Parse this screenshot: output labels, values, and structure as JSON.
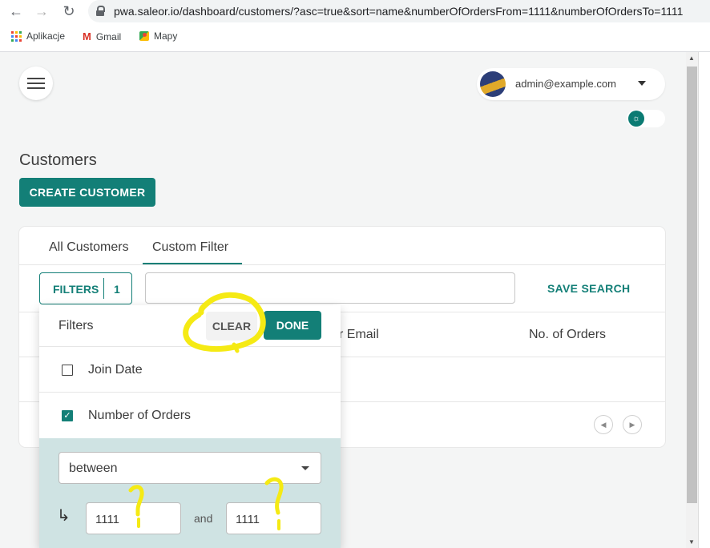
{
  "browser": {
    "url": "pwa.saleor.io/dashboard/customers/?asc=true&sort=name&numberOfOrdersFrom=1111&numberOfOrdersTo=1111",
    "bookmarks": [
      {
        "label": "Aplikacje",
        "icon": "apps-icon"
      },
      {
        "label": "Gmail",
        "icon": "gmail-icon"
      },
      {
        "label": "Mapy",
        "icon": "maps-icon"
      }
    ]
  },
  "header": {
    "user_email": "admin@example.com"
  },
  "page": {
    "title": "Customers",
    "create_button": "CREATE CUSTOMER"
  },
  "tabs": [
    {
      "label": "All Customers",
      "active": false
    },
    {
      "label": "Custom Filter",
      "active": true
    }
  ],
  "toolbar": {
    "filters_label": "FILTERS",
    "filters_count": "1",
    "search_value": "",
    "save_search": "SAVE SEARCH"
  },
  "table": {
    "columns_visible": [
      "r Email",
      "No. of Orders"
    ]
  },
  "filter_panel": {
    "title": "Filters",
    "clear_label": "CLEAR",
    "done_label": "DONE",
    "options": [
      {
        "label": "Join Date",
        "checked": false
      },
      {
        "label": "Number of Orders",
        "checked": true
      }
    ],
    "condition": "between",
    "from_value": "1111",
    "and_label": "and",
    "to_value": "1111"
  },
  "colors": {
    "accent": "#137f77",
    "filter_body_bg": "#cfe3e3",
    "annotation": "#f5ea14"
  }
}
